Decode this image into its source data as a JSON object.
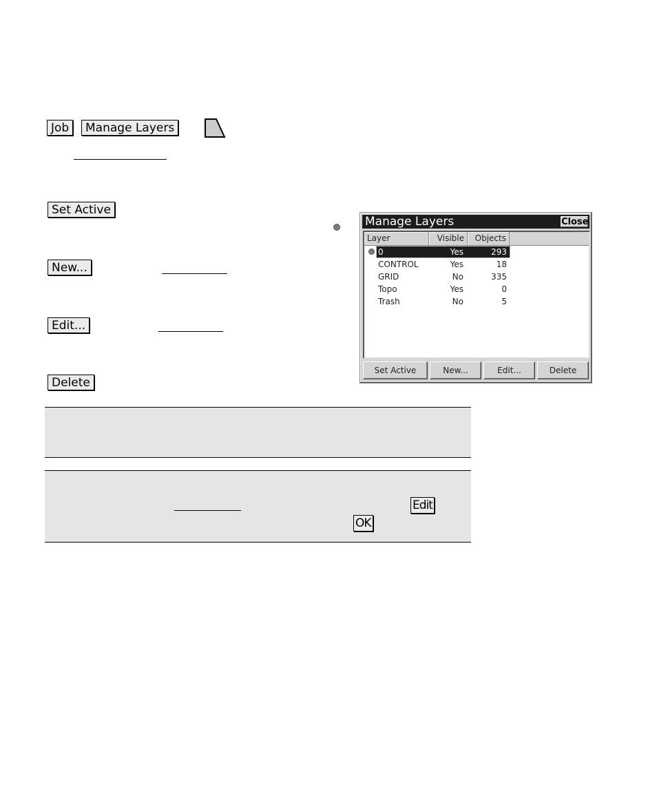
{
  "path_buttons": {
    "job": "Job",
    "manage_layers": "Manage Layers"
  },
  "icons": {
    "softkey_tab": "softkey-tab-icon",
    "active_layer_bullet": "active-layer-bullet-icon"
  },
  "doc_buttons": {
    "set_active": "Set Active",
    "new": "New...",
    "edit": "Edit...",
    "delete": "Delete"
  },
  "note2_buttons": {
    "edit": "Edit",
    "ok": "OK"
  },
  "dialog": {
    "title": "Manage Layers",
    "close_label": "Close",
    "columns": [
      "Layer",
      "Visible",
      "Objects"
    ],
    "rows": [
      {
        "layer": "0",
        "visible": "Yes",
        "objects": "293",
        "active": true,
        "selected": true
      },
      {
        "layer": "CONTROL",
        "visible": "Yes",
        "objects": "18",
        "active": false,
        "selected": false
      },
      {
        "layer": "GRID",
        "visible": "No",
        "objects": "335",
        "active": false,
        "selected": false
      },
      {
        "layer": "Topo",
        "visible": "Yes",
        "objects": "0",
        "active": false,
        "selected": false
      },
      {
        "layer": "Trash",
        "visible": "No",
        "objects": "5",
        "active": false,
        "selected": false
      }
    ],
    "buttons": [
      "Set Active",
      "New...",
      "Edit...",
      "Delete"
    ]
  },
  "colors": {
    "note_background": "#e5e5e5",
    "dialog_titlebar": "#1c1c1c",
    "dialog_face": "#d4d4d4",
    "active_bullet": "#7a7a7a"
  }
}
